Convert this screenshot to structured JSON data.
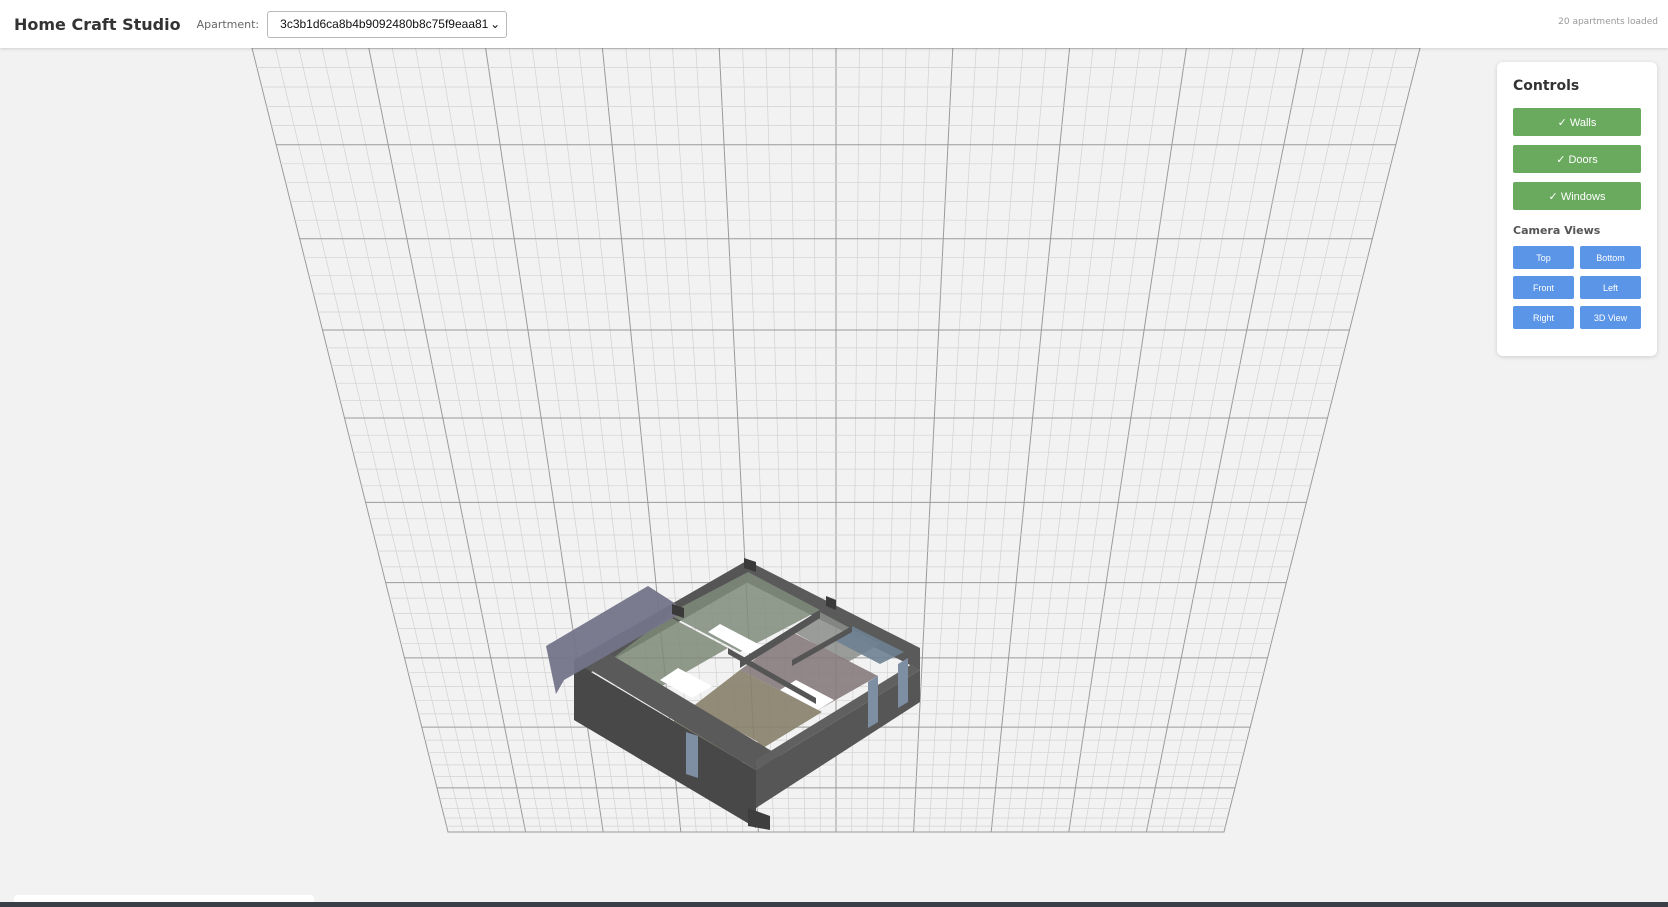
{
  "header": {
    "title": "Home Craft Studio",
    "apartment_label": "Apartment:",
    "apartment_selected": "3c3b1d6ca8b4b9092480b8c75f9eaa81",
    "status": "20 apartments loaded"
  },
  "controls": {
    "title": "Controls",
    "toggles": [
      {
        "label": "✓ Walls",
        "checked": true
      },
      {
        "label": "✓ Doors",
        "checked": true
      },
      {
        "label": "✓ Windows",
        "checked": true
      }
    ],
    "camera_title": "Camera Views",
    "camera_buttons": [
      "Top",
      "Bottom",
      "Front",
      "Left",
      "Right",
      "3D View"
    ]
  },
  "colors": {
    "toggle_active": "#6aaa5e",
    "camera_button": "#5b95e8",
    "background": "#f2f2f2",
    "wall": "#4d4d4d"
  }
}
